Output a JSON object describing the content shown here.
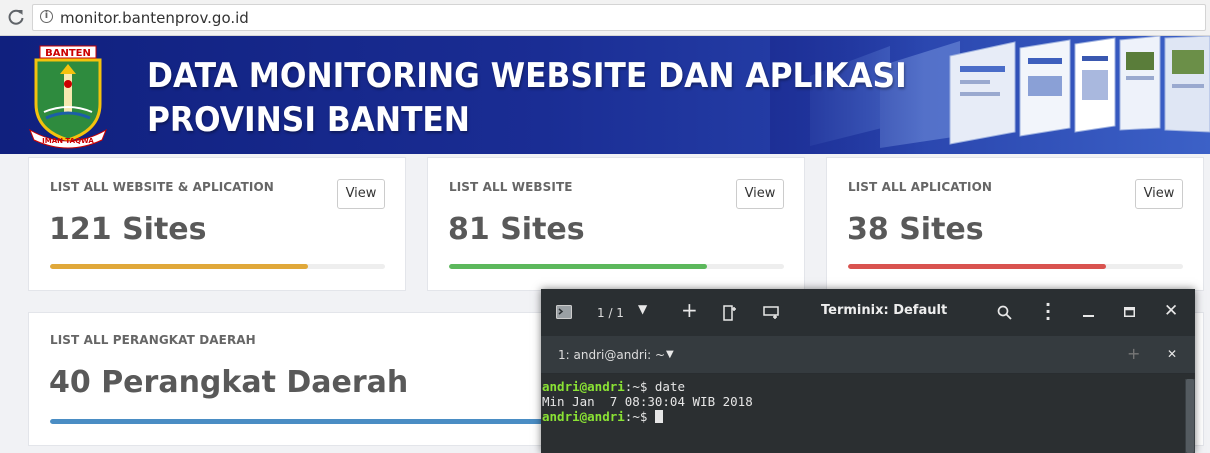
{
  "browser": {
    "url": "monitor.bantenprov.go.id"
  },
  "banner": {
    "logo_text_top": "BANTEN",
    "logo_text_bottom": "IMAN TAQWA",
    "title_line1": "DATA MONITORING WEBSITE DAN APLIKASI",
    "title_line2": "PROVINSI BANTEN"
  },
  "cards": [
    {
      "label": "LIST ALL WEBSITE & APLICATION",
      "value": "121 Sites",
      "button": "View",
      "progress": 0.77,
      "color": "#e0a83a"
    },
    {
      "label": "LIST ALL WEBSITE",
      "value": "81 Sites",
      "button": "View",
      "progress": 0.77,
      "color": "#5cb85c"
    },
    {
      "label": "LIST ALL APLICATION",
      "value": "38 Sites",
      "button": "View",
      "progress": 0.77,
      "color": "#d9534f"
    },
    {
      "label": "LIST ALL PERANGKAT DAERAH",
      "value": "40 Perangkat Daerah",
      "progress": 1.0,
      "color": "#4a8dc4"
    }
  ],
  "terminal": {
    "title": "Terminix: Default",
    "pages": "1 / 1",
    "tab_label": "1: andri@andri: ~",
    "lines": [
      {
        "user": "andri@andri",
        "path": ":~$",
        "command": " date"
      },
      {
        "output": "Min Jan  7 08:30:04 WIB 2018"
      },
      {
        "user": "andri@andri",
        "path": ":~$",
        "command": " "
      }
    ]
  }
}
